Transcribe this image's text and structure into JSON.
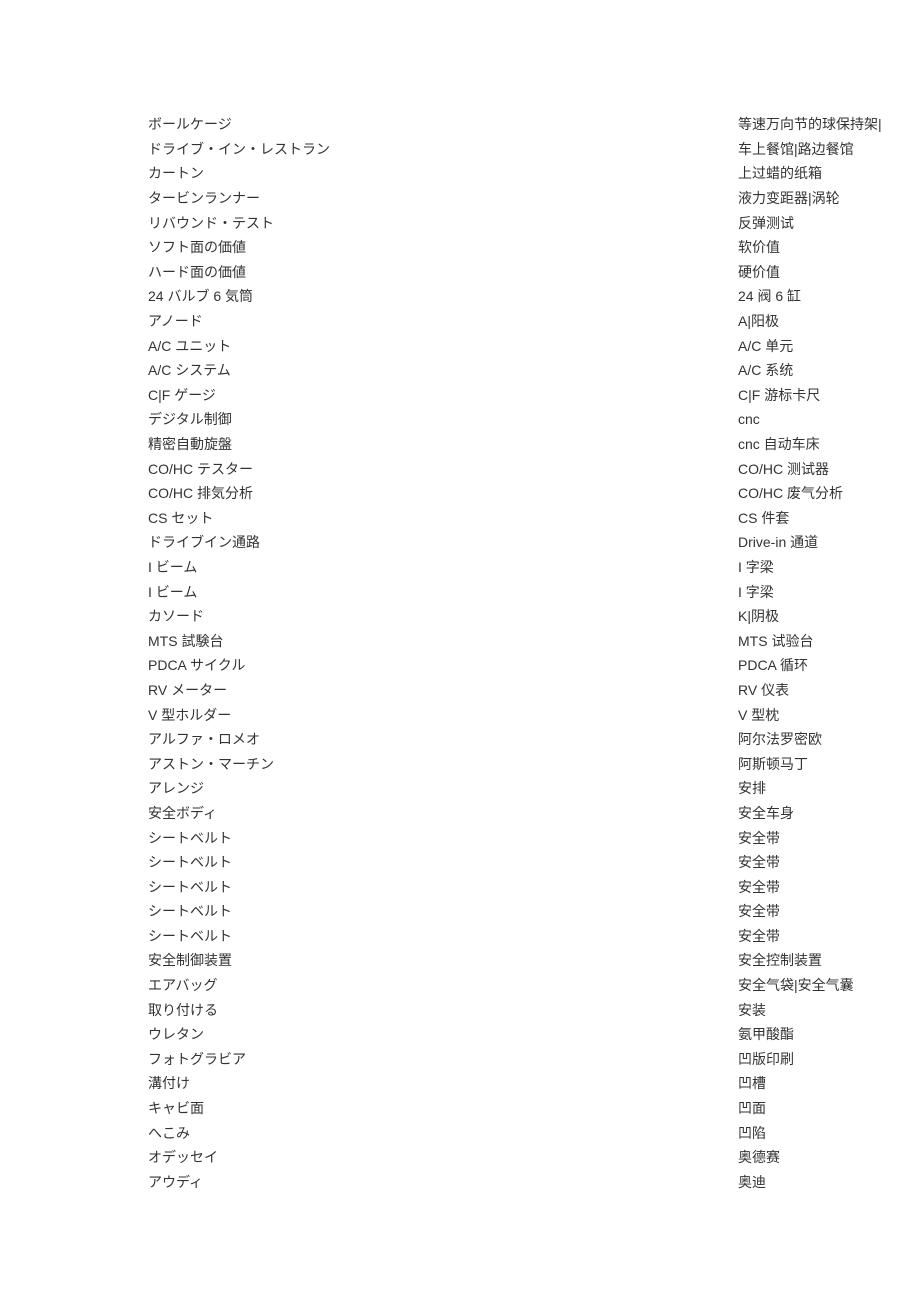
{
  "rows": [
    {
      "jp": "ボールケージ",
      "zh": "等速万向节的球保持架|"
    },
    {
      "jp": "ドライブ・イン・レストラン",
      "zh": "车上餐馆|路边餐馆"
    },
    {
      "jp": "カートン",
      "zh": "上过蜡的纸箱"
    },
    {
      "jp": "タービンランナー",
      "zh": "液力变距器|涡轮"
    },
    {
      "jp": "リバウンド・テスト",
      "zh": "反弹测试"
    },
    {
      "jp": "ソフト面の価値",
      "zh": "软价值"
    },
    {
      "jp": "ハード面の価値",
      "zh": "硬价值"
    },
    {
      "jp": "24 バルブ 6 気筒",
      "zh": "24 阀 6 缸"
    },
    {
      "jp": "アノード",
      "zh": "A|阳极"
    },
    {
      "jp": "A/C ユニット",
      "zh": "A/C 单元"
    },
    {
      "jp": "A/C システム",
      "zh": "A/C 系统"
    },
    {
      "jp": "C|F ゲージ",
      "zh": "C|F 游标卡尺"
    },
    {
      "jp": "デジタル制御",
      "zh": "cnc"
    },
    {
      "jp": "精密自動旋盤",
      "zh": "cnc 自动车床"
    },
    {
      "jp": "CO/HC テスター",
      "zh": "CO/HC 测试器"
    },
    {
      "jp": "CO/HC 排気分析",
      "zh": "CO/HC 废气分析"
    },
    {
      "jp": "CS セット",
      "zh": "CS 件套"
    },
    {
      "jp": "ドライブイン通路",
      "zh": "Drive-in 通道"
    },
    {
      "jp": "I ビーム",
      "zh": "I 字梁"
    },
    {
      "jp": "I ビーム",
      "zh": "I 字梁"
    },
    {
      "jp": "カソード",
      "zh": "K|阴极"
    },
    {
      "jp": "MTS 試験台",
      "zh": "MTS 试验台"
    },
    {
      "jp": "PDCA サイクル",
      "zh": "PDCA 循环"
    },
    {
      "jp": "RV メーター",
      "zh": "RV 仪表"
    },
    {
      "jp": "V 型ホルダー",
      "zh": "V 型枕"
    },
    {
      "jp": "アルファ・ロメオ",
      "zh": "阿尔法罗密欧"
    },
    {
      "jp": "アストン・マーチン",
      "zh": "阿斯顿马丁"
    },
    {
      "jp": "アレンジ",
      "zh": "安排"
    },
    {
      "jp": "安全ボディ",
      "zh": "安全车身"
    },
    {
      "jp": "シートベルト",
      "zh": "安全带"
    },
    {
      "jp": "シートベルト",
      "zh": "安全带"
    },
    {
      "jp": "シートベルト",
      "zh": "安全带"
    },
    {
      "jp": "シートベルト",
      "zh": "安全带"
    },
    {
      "jp": "シートベルト",
      "zh": "安全带"
    },
    {
      "jp": "安全制御装置",
      "zh": "安全控制装置"
    },
    {
      "jp": "エアバッグ",
      "zh": "安全气袋|安全气囊"
    },
    {
      "jp": "取り付ける",
      "zh": "安装"
    },
    {
      "jp": "ウレタン",
      "zh": "氨甲酸酯"
    },
    {
      "jp": "フォトグラビア",
      "zh": "凹版印刷"
    },
    {
      "jp": "溝付け",
      "zh": "凹槽"
    },
    {
      "jp": "キャビ面",
      "zh": "凹面"
    },
    {
      "jp": "へこみ",
      "zh": "凹陷"
    },
    {
      "jp": "オデッセイ",
      "zh": "奥德赛"
    },
    {
      "jp": "アウディ",
      "zh": "奥迪"
    }
  ]
}
